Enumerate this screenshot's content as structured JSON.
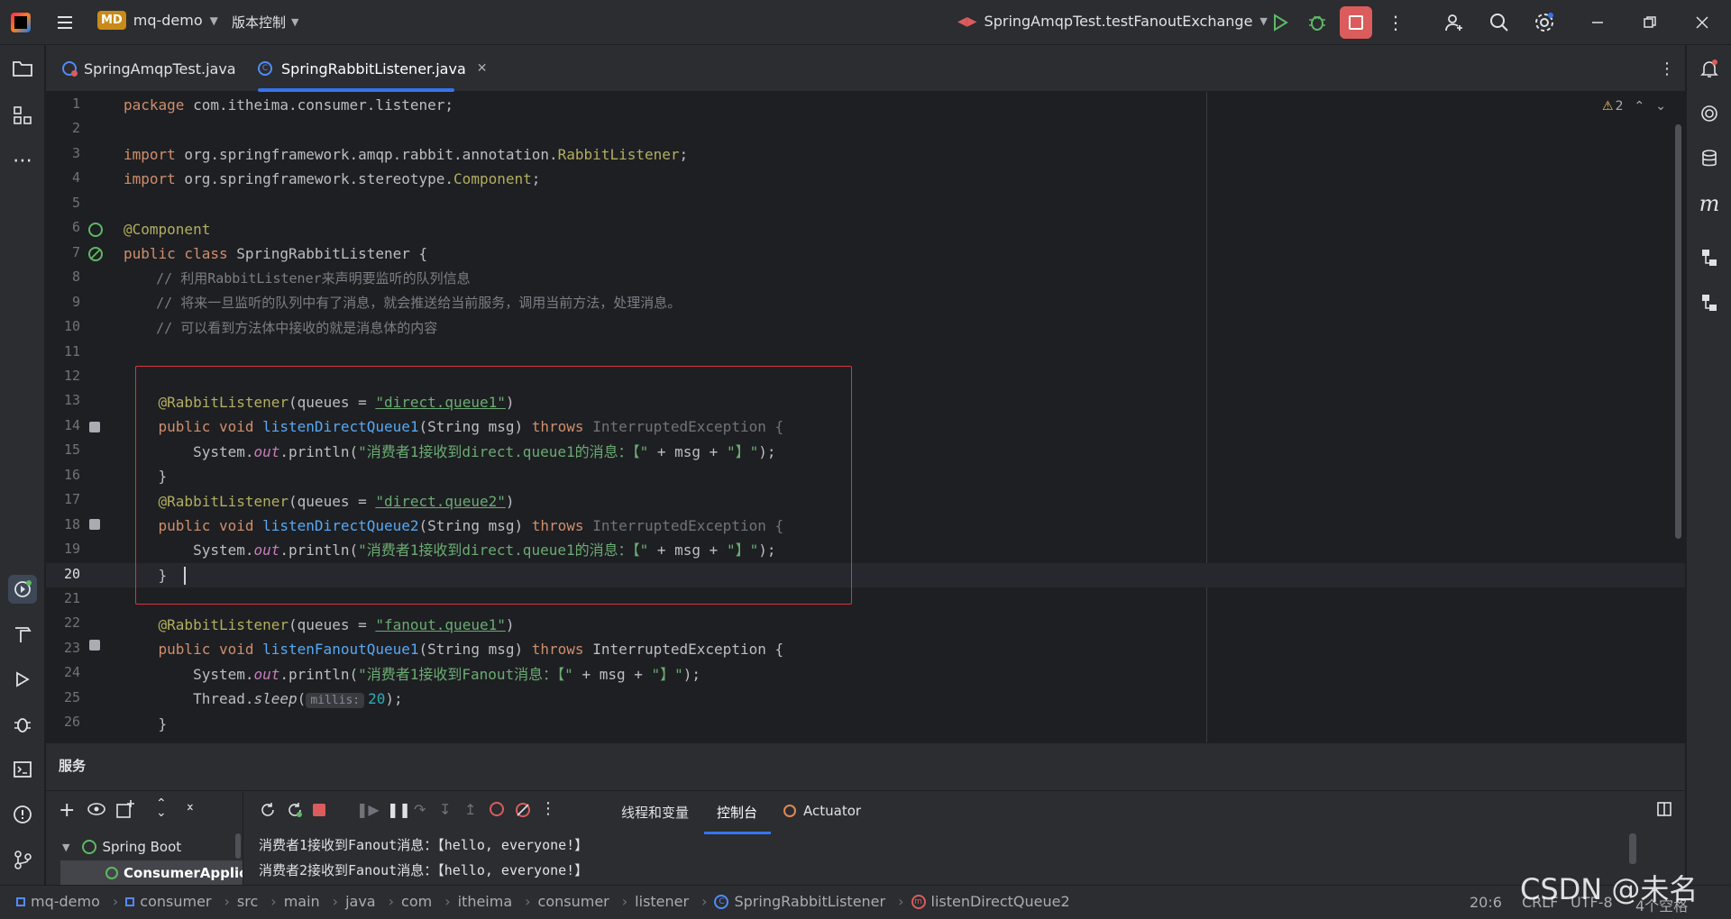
{
  "titlebar": {
    "logo_text": "MD",
    "project": "mq-demo",
    "vcs": "版本控制",
    "run_config": "SpringAmqpTest.testFanoutExchange"
  },
  "tabs": [
    {
      "label": "SpringAmqpTest.java"
    },
    {
      "label": "SpringRabbitListener.java"
    }
  ],
  "editor": {
    "warnings": "2",
    "line_numbers": [
      "1",
      "2",
      "3",
      "4",
      "5",
      "6",
      "7",
      "8",
      "9",
      "10",
      "11",
      "12",
      "13",
      "14",
      "15",
      "16",
      "17",
      "18",
      "19",
      "20",
      "21",
      "22",
      "23",
      "24",
      "25",
      "26"
    ],
    "code": {
      "l1a": "package",
      "l1b": " com.itheima.consumer.listener;",
      "l3a": "import",
      "l3b": " org.springframework.amqp.rabbit.annotation.",
      "l3c": "RabbitListener",
      "l3d": ";",
      "l4a": "import",
      "l4b": " org.springframework.stereotype.",
      "l4c": "Component",
      "l4d": ";",
      "l6": "@Component",
      "l7a": "public class ",
      "l7b": "SpringRabbitListener {",
      "l8": "    // 利用RabbitListener来声明要监听的队列信息",
      "l9": "    // 将来一旦监听的队列中有了消息，就会推送给当前服务，调用当前方法，处理消息。",
      "l10": "    // 可以看到方法体中接收的就是消息体的内容",
      "l13a": "    @RabbitListener",
      "l13b": "(queues = ",
      "l13c": "\"direct.queue1\"",
      "l13d": ")",
      "l14a": "    public void ",
      "l14b": "listenDirectQueue1",
      "l14c": "(String msg) ",
      "l14d": "throws ",
      "l14e": "InterruptedException {",
      "l15a": "        System.",
      "l15b": "out",
      "l15c": ".println(",
      "l15d": "\"消费者1接收到direct.queue1的消息：【\"",
      "l15e": " + msg + ",
      "l15f": "\"】\"",
      "l15g": ");",
      "l16": "    }",
      "l17a": "    @RabbitListener",
      "l17b": "(queues = ",
      "l17c": "\"direct.queue2\"",
      "l17d": ")",
      "l18a": "    public void ",
      "l18b": "listenDirectQueue2",
      "l18c": "(String msg) ",
      "l18d": "throws ",
      "l18e": "InterruptedException {",
      "l19a": "        System.",
      "l19b": "out",
      "l19c": ".println(",
      "l19d": "\"消费者1接收到direct.queue1的消息：【\"",
      "l19e": " + msg + ",
      "l19f": "\"】\"",
      "l19g": ");",
      "l20": "    }",
      "l22a": "    @RabbitListener",
      "l22b": "(queues = ",
      "l22c": "\"fanout.queue1\"",
      "l22d": ")",
      "l23a": "    public void ",
      "l23b": "listenFanoutQueue1",
      "l23c": "(String msg) ",
      "l23d": "throws ",
      "l23e": "InterruptedException {",
      "l24a": "        System.",
      "l24b": "out",
      "l24c": ".println(",
      "l24d": "\"消费者1接收到Fanout消息：【\"",
      "l24e": " + msg + ",
      "l24f": "\"】\"",
      "l24g": ");",
      "l25a": "        Thread.",
      "l25b": "sleep",
      "l25c": "(",
      "l25hint": "millis:",
      "l25d": "20",
      "l25e": ");",
      "l26": "    }"
    }
  },
  "services": {
    "title": "服务",
    "tabs": [
      "线程和变量",
      "控制台",
      "Actuator"
    ],
    "tree": [
      {
        "label": "Spring Boot"
      },
      {
        "label": "ConsumerApplica"
      }
    ],
    "console": [
      "消费者1接收到Fanout消息：【hello, everyone!】",
      "消费者2接收到Fanout消息：【hello, everyone!】"
    ]
  },
  "statusbar": {
    "crumbs": [
      "mq-demo",
      "consumer",
      "src",
      "main",
      "java",
      "com",
      "itheima",
      "consumer",
      "listener",
      "SpringRabbitListener",
      "listenDirectQueue2"
    ],
    "position": "20:6",
    "line_sep": "CRLF",
    "encoding": "UTF-8",
    "indent": "4个空格"
  },
  "watermark": "CSDN @未名",
  "colors": {
    "accent": "#3574f0",
    "highlight_box": "#d9363e",
    "stop_button": "#db5c5c"
  }
}
